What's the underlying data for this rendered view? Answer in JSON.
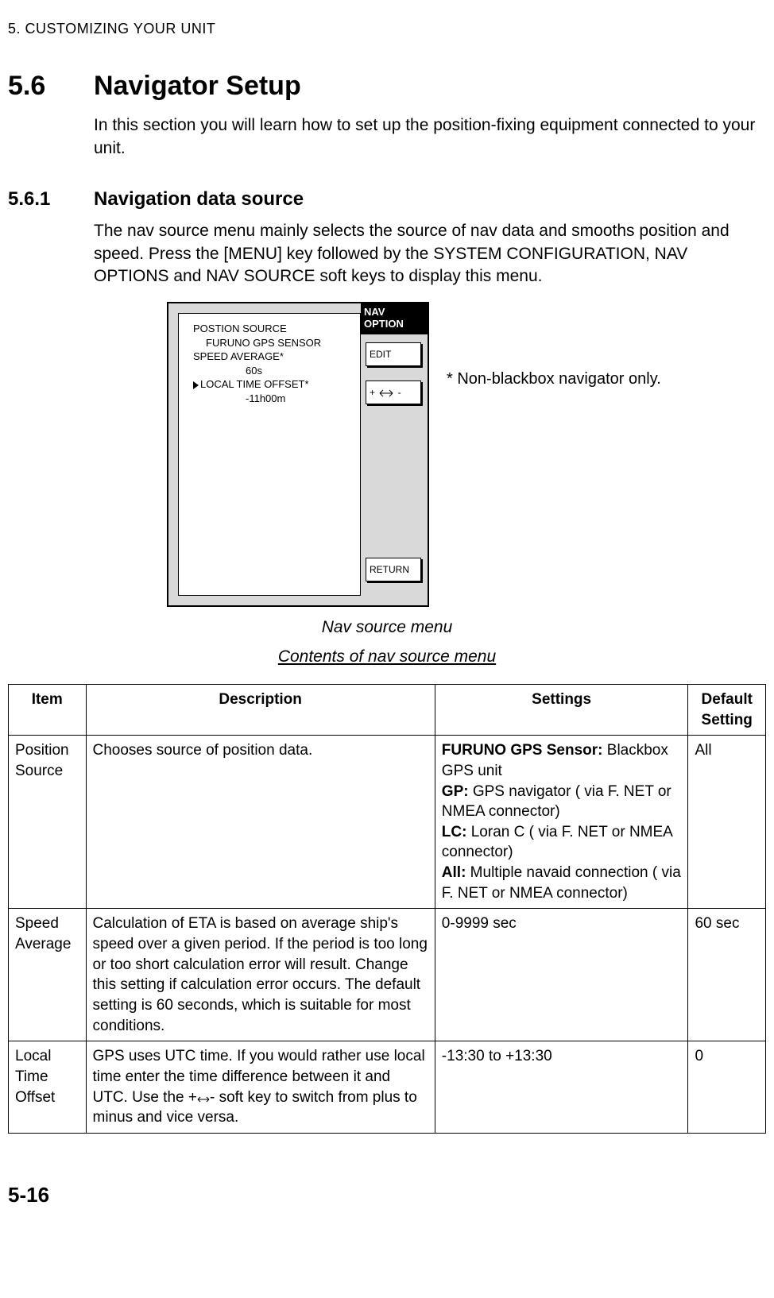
{
  "chapterHeader": "5. CUSTOMIZING YOUR UNIT",
  "section": {
    "num": "5.6",
    "title": "Navigator Setup",
    "intro": "In this section you will learn how to set up the position-fixing equipment connected to your unit."
  },
  "subsection": {
    "num": "5.6.1",
    "title": "Navigation data source",
    "text": "The nav source menu mainly selects the source of nav data and smooths position and speed. Press the [MENU] key followed by the SYSTEM CONFIGURATION, NAV OPTIONS and NAV SOURCE soft keys to display this menu."
  },
  "device": {
    "line1": "POSTION SOURCE",
    "line2": "FURUNO GPS SENSOR",
    "line3": "SPEED AVERAGE*",
    "line4": "60s",
    "line5": "LOCAL TIME OFFSET*",
    "line6": "-11h00m",
    "sideHeader1": "NAV",
    "sideHeader2": "OPTION",
    "softkeyEdit": "EDIT",
    "softkeyPlusMinusPrefix": "+ ",
    "softkeyPlusMinusSuffix": " -",
    "softkeyReturn": "RETURN"
  },
  "noteRight": "* Non-blackbox navigator only.",
  "caption1": "Nav source menu",
  "caption2": "Contents of nav source menu",
  "table": {
    "headers": {
      "item": "Item",
      "desc": "Description",
      "settings": "Settings",
      "def": "Default Setting"
    },
    "rows": [
      {
        "item": "Position Source",
        "desc": "Chooses source of position data.",
        "settings": {
          "b1": "FURUNO GPS Sensor:",
          "t1": " Blackbox GPS unit",
          "b2": "GP:",
          "t2": " GPS navigator ( via F. NET or NMEA connector)",
          "b3": "LC:",
          "t3": " Loran C ( via F. NET or NMEA connector)",
          "b4": "All:",
          "t4": " Multiple navaid connection ( via F. NET or NMEA connector)"
        },
        "def": "All"
      },
      {
        "item": "Speed Average",
        "desc": "Calculation of ETA is based on average ship's speed over a given period. If the period is too long or too short calculation error will result. Change this setting if calculation error occurs. The default setting is 60 seconds, which is suitable for most conditions.",
        "settingsPlain": "0-9999 sec",
        "def": "60 sec"
      },
      {
        "item": "Local Time Offset",
        "descPrefix": "GPS uses UTC time. If you would rather use local time enter the time difference between it and UTC. Use the +",
        "descSuffix": "- soft key to switch from plus to minus and vice versa.",
        "settingsPlain": "-13:30 to +13:30",
        "def": "0"
      }
    ]
  },
  "pageNum": "5-16"
}
